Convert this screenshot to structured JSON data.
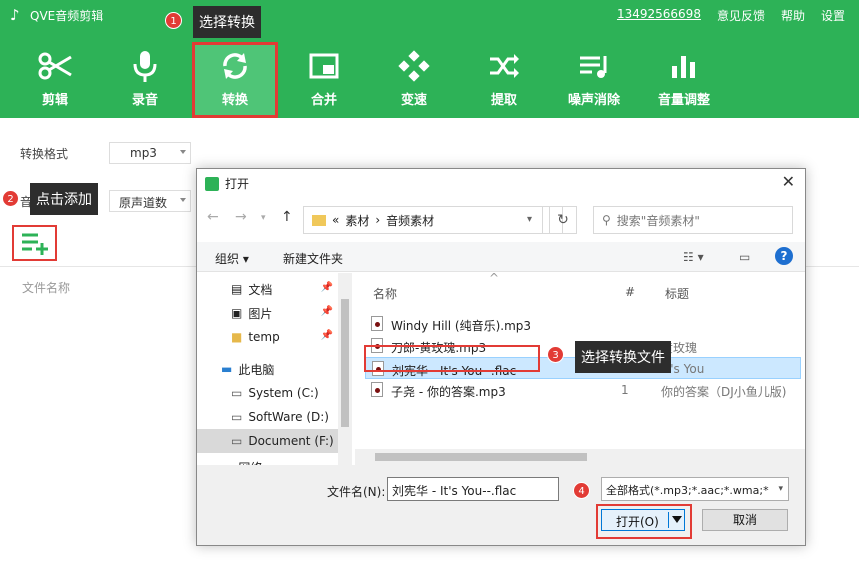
{
  "app": {
    "title": "QVE音频剪辑",
    "top_links": {
      "phone": "13492566698",
      "feedback": "意见反馈",
      "help": "帮助",
      "settings": "设置"
    },
    "toolbar": [
      {
        "label": "剪辑",
        "icon": "scissors-icon"
      },
      {
        "label": "录音",
        "icon": "microphone-icon"
      },
      {
        "label": "转换",
        "icon": "convert-icon"
      },
      {
        "label": "合并",
        "icon": "merge-icon"
      },
      {
        "label": "变速",
        "icon": "speed-icon"
      },
      {
        "label": "提取",
        "icon": "extract-icon"
      },
      {
        "label": "噪声消除",
        "icon": "noise-removal-icon"
      },
      {
        "label": "音量调整",
        "icon": "volume-adjust-icon"
      }
    ],
    "active_tool": "转换",
    "format_label": "转换格式",
    "format_value": "mp3",
    "channel_label_partial": "音",
    "channel_value": "原声道数",
    "file_name_header": "文件名称"
  },
  "callouts": [
    {
      "num": "1",
      "text": "选择转换"
    },
    {
      "num": "2",
      "text": "点击添加"
    },
    {
      "num": "3",
      "text": "选择转换文件"
    },
    {
      "num": "4",
      "text": ""
    }
  ],
  "dialog": {
    "title": "打开",
    "breadcrumb": {
      "prefix": "«",
      "part1": "素材",
      "sep": "›",
      "part2": "音频素材"
    },
    "search_placeholder": "搜索\"音频素材\"",
    "commands": {
      "organize": "组织 ▾",
      "new_folder": "新建文件夹"
    },
    "nav_items": [
      {
        "label": "文档",
        "pinned": true
      },
      {
        "label": "图片",
        "pinned": true
      },
      {
        "label": "temp",
        "pinned": true
      },
      {
        "label": "此电脑",
        "pinned": false
      },
      {
        "label": "System (C:)",
        "pinned": false
      },
      {
        "label": "SoftWare (D:)",
        "pinned": false
      },
      {
        "label": "Document (F:)",
        "pinned": false
      },
      {
        "label": "网络",
        "pinned": false
      }
    ],
    "columns": {
      "name": "名称",
      "num": "#",
      "title": "标题"
    },
    "files": [
      {
        "name": "Windy Hill (纯音乐).mp3",
        "num": "",
        "title": ""
      },
      {
        "name": "刀郎-黄玫瑰.mp3",
        "num": "",
        "title": "黄玫瑰"
      },
      {
        "name": "刘宪华 - It's You--.flac",
        "num": "",
        "title": "It's You"
      },
      {
        "name": "子尧 - 你的答案.mp3",
        "num": "1",
        "title": "你的答案（DJ小鱼儿版)"
      }
    ],
    "file_name_label": "文件名(N):",
    "file_name_value": "刘宪华 - It's You--.flac",
    "file_type": "全部格式(*.mp3;*.aac;*.wma;*",
    "open_label": "打开(O)",
    "cancel_label": "取消"
  }
}
